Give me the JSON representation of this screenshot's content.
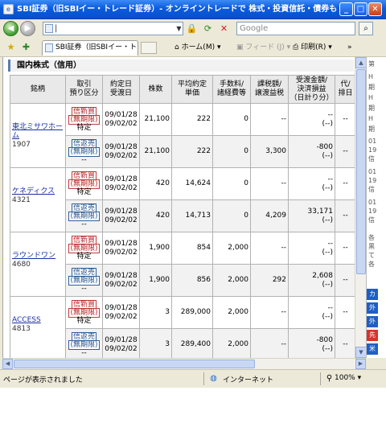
{
  "window": {
    "title": "SBI証券（旧SBIイー・トレード証券）- オンライントレードで 株式・投資信託・債券も - - Win...",
    "buttons": {
      "minimize": "_",
      "maximize": "□",
      "close": "✕"
    }
  },
  "address_bar": {
    "url": "|",
    "search_placeholder": "Google",
    "back_glyph": "◀",
    "forward_glyph": "▶"
  },
  "tab_bar": {
    "tab_label": "SBI証券（旧SBIイー・トレー...",
    "home_label": "ホーム(M)",
    "feed_label": "フィード (J)",
    "print_label": "印刷(R)"
  },
  "section": {
    "title": "国内株式（信用）"
  },
  "table": {
    "headers": [
      "銘柄",
      "取引\n預り区分",
      "約定日\n受渡日",
      "株数",
      "平均約定\n単価",
      "手数料/\n諸経費等",
      "課税額/\n譲渡益税",
      "受渡金額/\n決済損益\n（日計り分）",
      "代/\n排日"
    ],
    "stocks": [
      {
        "name": "東北ミサワホーム",
        "code": "1907",
        "rows": [
          {
            "tag1": "信新買",
            "tag2": "(無期限)",
            "account": "特定",
            "trade_date": "09/01/28",
            "settle_date": "09/02/02",
            "shares": "21,100",
            "price": "222",
            "fee": "0",
            "tax": "--",
            "amount": "--",
            "pl": "(--)",
            "dai": "--"
          },
          {
            "tag1": "信返売",
            "tag2": "(無期限)",
            "account": "--",
            "trade_date": "09/01/28",
            "settle_date": "09/02/02",
            "shares": "21,100",
            "price": "222",
            "fee": "0",
            "tax": "3,300",
            "amount": "-800",
            "pl": "(--)",
            "dai": "--"
          }
        ]
      },
      {
        "name": "ケネディクス",
        "code": "4321",
        "rows": [
          {
            "tag1": "信新買",
            "tag2": "(無期限)",
            "account": "特定",
            "trade_date": "09/01/28",
            "settle_date": "09/02/02",
            "shares": "420",
            "price": "14,624",
            "fee": "0",
            "tax": "--",
            "amount": "--",
            "pl": "(--)",
            "dai": "--"
          },
          {
            "tag1": "信返売",
            "tag2": "(無期限)",
            "account": "--",
            "trade_date": "09/01/28",
            "settle_date": "09/02/02",
            "shares": "420",
            "price": "14,713",
            "fee": "0",
            "tax": "4,209",
            "amount": "33,171",
            "pl": "(--)",
            "dai": "--"
          }
        ]
      },
      {
        "name": "ラウンドワン",
        "code": "4680",
        "rows": [
          {
            "tag1": "信新買",
            "tag2": "(無期限)",
            "account": "特定",
            "trade_date": "09/01/28",
            "settle_date": "09/02/02",
            "shares": "1,900",
            "price": "854",
            "fee": "2,000",
            "tax": "--",
            "amount": "--",
            "pl": "(--)",
            "dai": "--"
          },
          {
            "tag1": "信返売",
            "tag2": "(無期限)",
            "account": "--",
            "trade_date": "09/01/28",
            "settle_date": "09/02/02",
            "shares": "1,900",
            "price": "856",
            "fee": "2,000",
            "tax": "292",
            "amount": "2,608",
            "pl": "(--)",
            "dai": "--"
          }
        ]
      },
      {
        "name": "ACCESS",
        "code": "4813",
        "rows": [
          {
            "tag1": "信新買",
            "tag2": "(無期限)",
            "account": "特定",
            "trade_date": "09/01/28",
            "settle_date": "09/02/02",
            "shares": "3",
            "price": "289,000",
            "fee": "2,000",
            "tax": "--",
            "amount": "--",
            "pl": "(--)",
            "dai": "--"
          },
          {
            "tag1": "信返売",
            "tag2": "(無期限)",
            "account": "--",
            "trade_date": "09/01/28",
            "settle_date": "09/02/02",
            "shares": "3",
            "price": "289,400",
            "fee": "2,000",
            "tax": "--",
            "amount": "-800",
            "pl": "(--)",
            "dai": "--"
          }
        ]
      }
    ]
  },
  "side_panel": {
    "texts": [
      "第",
      "H",
      "期",
      "H",
      "期",
      "H",
      "期",
      "01",
      "19",
      "信",
      "01",
      "19",
      "信",
      "01",
      "19",
      "信",
      "各",
      "黒",
      "て",
      "各"
    ],
    "badges": [
      "カ",
      "外",
      "外",
      "先",
      "米"
    ],
    "badge_colors": [
      "#1e5fc6",
      "#1e5fc6",
      "#1e5fc6",
      "#d8322c",
      "#1e5fc6"
    ]
  },
  "status_bar": {
    "text": "ページが表示されました",
    "zone": "インターネット",
    "zoom": "100%"
  }
}
